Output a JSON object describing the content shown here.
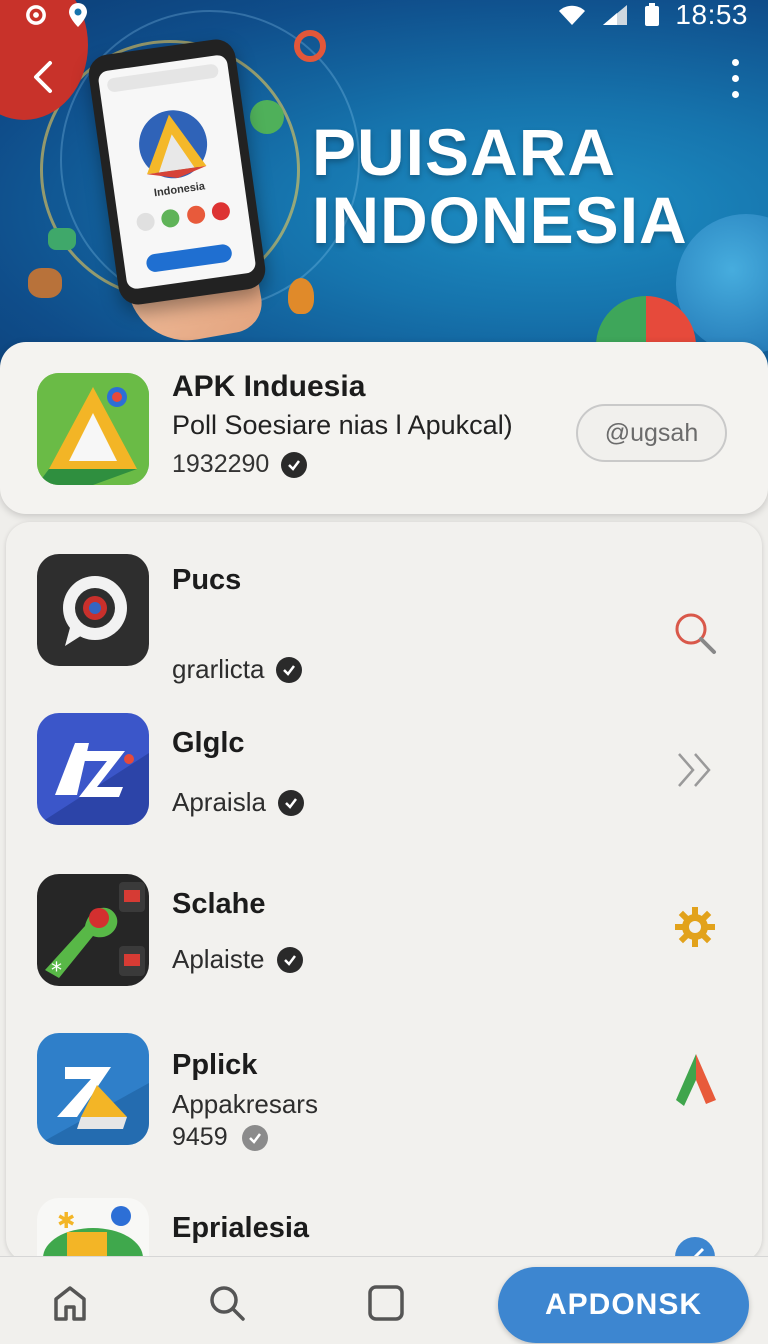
{
  "status_bar": {
    "time": "18:53"
  },
  "hero": {
    "title_line1": "PUISARA",
    "title_line2": "INDONESIA",
    "phone_caption": "Indonesia"
  },
  "featured": {
    "name": "APK Induesia",
    "subtitle": "Poll Soesiare nias l Apukcal)",
    "count": "1932290",
    "action_label": "@ugsah",
    "icon": "triangle-logo-icon"
  },
  "apps": [
    {
      "name": "Pucs",
      "subtitle": "grarlicta",
      "icon": "chat-ring-icon",
      "action_icon": "search-icon"
    },
    {
      "name": "Glglc",
      "subtitle": "Apraisla",
      "icon": "az-logo-icon",
      "action_icon": "double-chevron-icon"
    },
    {
      "name": "Sclahe",
      "subtitle": "Aplaiste",
      "icon": "wrench-icon",
      "action_icon": "gear-icon"
    },
    {
      "name": "Pplick",
      "subtitle": "Appakresars",
      "meta": "9459",
      "icon": "z-logo-icon",
      "action_icon": "colored-arrow-icon"
    },
    {
      "name": "Eprialesia",
      "icon": "puzzle-icon",
      "action_icon": "edit-badge-icon"
    }
  ],
  "bottom_nav": {
    "items": [
      "home-icon",
      "search-icon",
      "square-icon"
    ],
    "cta_label": "APDONSK"
  },
  "colors": {
    "accent": "#3d86d0",
    "hero": "#1674ad",
    "badge": "#c8322a"
  }
}
